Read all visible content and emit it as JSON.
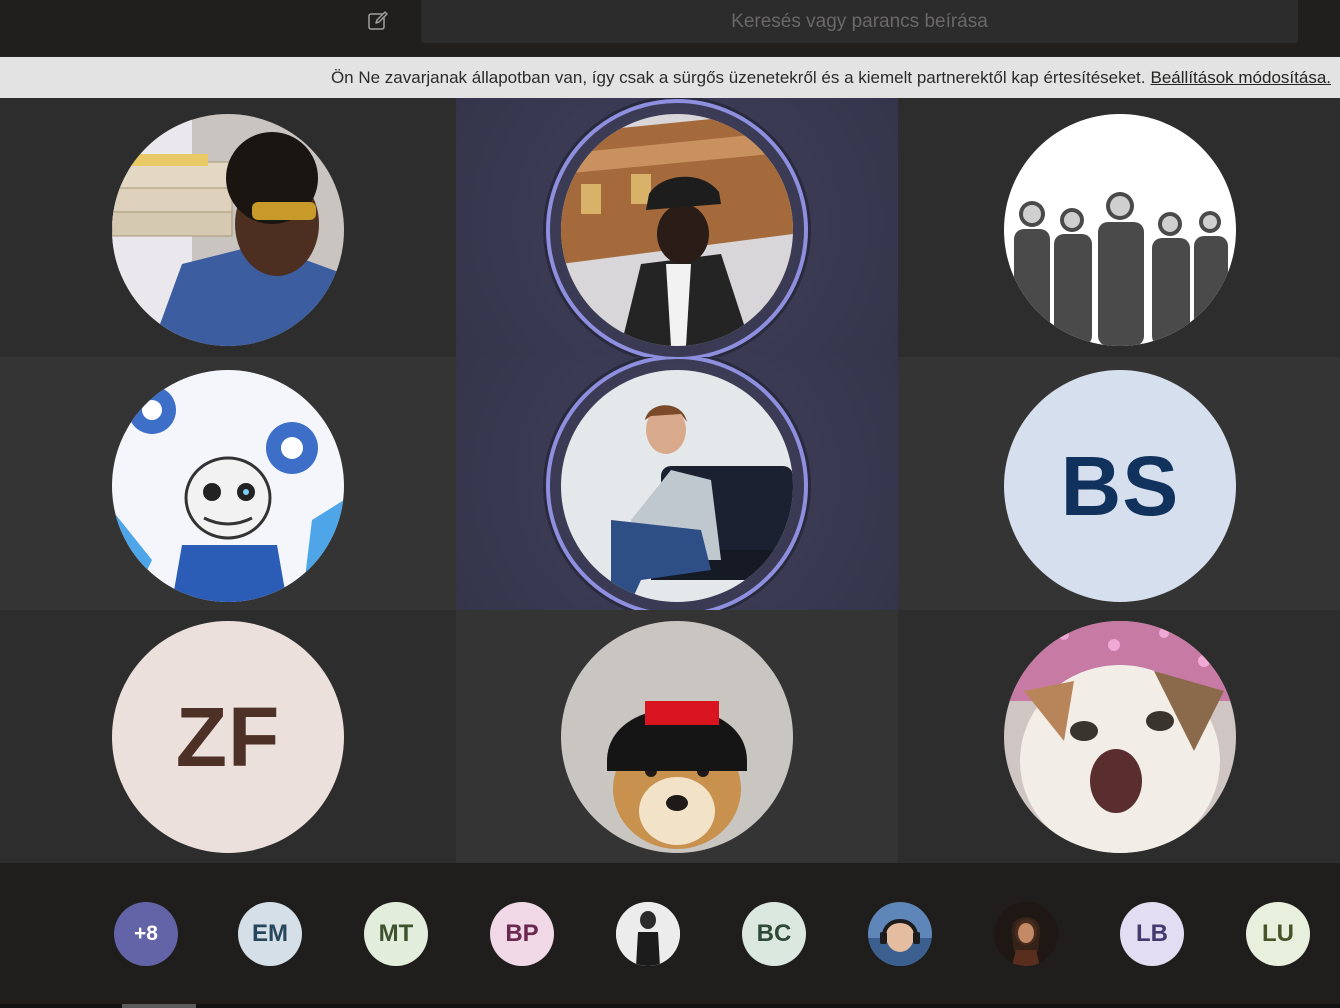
{
  "search": {
    "placeholder": "Keresés vagy parancs beírása"
  },
  "banner": {
    "message": "Ön Ne zavarjanak állapotban van, így csak a sürgős üzenetekről és a kiemelt partnerektől kap értesítéseket.",
    "link": "Beállítások módosítása."
  },
  "stage": {
    "participants": [
      {
        "type": "photo",
        "desc": "pizza-delivery-photo"
      },
      {
        "type": "photo",
        "desc": "coffin-dance-photo",
        "speaking": true
      },
      {
        "type": "photo",
        "desc": "band-photo"
      },
      {
        "type": "photo",
        "desc": "cartoon-skeleton-photo"
      },
      {
        "type": "photo",
        "desc": "man-on-couch-photo",
        "speaking": true
      },
      {
        "type": "initials",
        "initials": "BS",
        "bg": "#d5dfee",
        "fg": "#12325e"
      },
      {
        "type": "initials",
        "initials": "ZF",
        "bg": "#ebe0dc",
        "fg": "#4e3126"
      },
      {
        "type": "photo",
        "desc": "dog-supreme-hat-photo"
      },
      {
        "type": "photo",
        "desc": "cat-photo"
      }
    ]
  },
  "roster": {
    "overflow": "+8",
    "items": [
      {
        "type": "initials",
        "initials": "EM",
        "bg": "#d4dfe7",
        "fg": "#28465a"
      },
      {
        "type": "initials",
        "initials": "MT",
        "bg": "#e3eddc",
        "fg": "#3e5230"
      },
      {
        "type": "initials",
        "initials": "BP",
        "bg": "#f0d8e6",
        "fg": "#6a2750"
      },
      {
        "type": "photo",
        "desc": "person-bw-photo"
      },
      {
        "type": "initials",
        "initials": "BC",
        "bg": "#dbe8e0",
        "fg": "#2d4a38"
      },
      {
        "type": "photo",
        "desc": "boy-headphones-photo"
      },
      {
        "type": "photo",
        "desc": "woman-dark-photo"
      },
      {
        "type": "initials",
        "initials": "LB",
        "bg": "#e2ddf2",
        "fg": "#453a70"
      },
      {
        "type": "initials",
        "initials": "LU",
        "bg": "#e9efdd",
        "fg": "#48532a"
      }
    ]
  },
  "colors": {
    "accent": "#6264a7",
    "ring": "#8f8fe0"
  }
}
